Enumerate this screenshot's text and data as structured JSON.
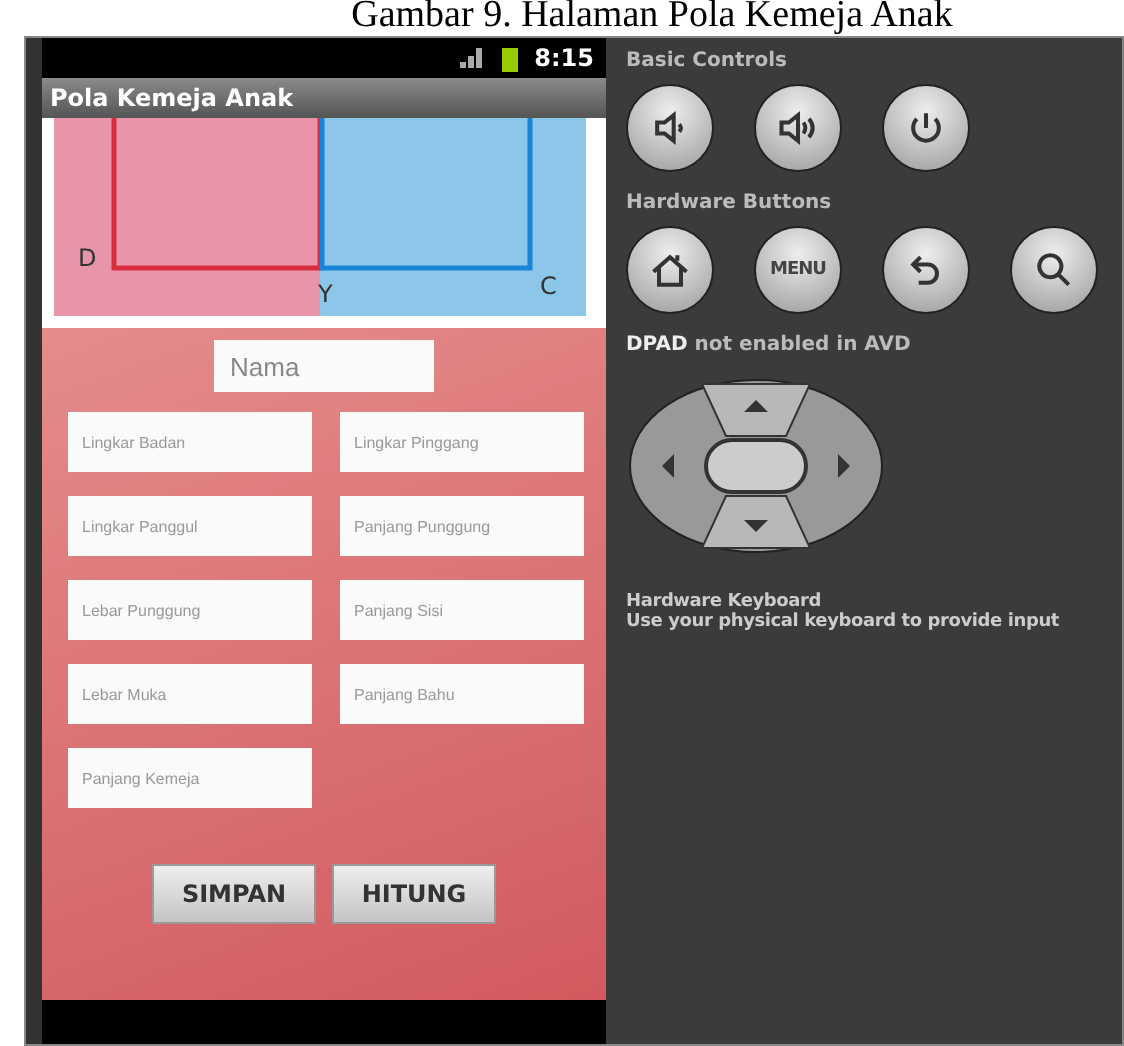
{
  "caption": "Gambar 9. Halaman Pola Kemeja Anak",
  "status_bar": {
    "time": "8:15"
  },
  "app_bar": {
    "title": "Pola Kemeja Anak"
  },
  "diagram": {
    "labels": [
      "D",
      "Y",
      "C"
    ]
  },
  "form": {
    "name_field": {
      "placeholder": "Nama"
    },
    "fields": [
      {
        "placeholder": "Lingkar Badan"
      },
      {
        "placeholder": "Lingkar Pinggang"
      },
      {
        "placeholder": "Lingkar Panggul"
      },
      {
        "placeholder": "Panjang Punggung"
      },
      {
        "placeholder": "Lebar Punggung"
      },
      {
        "placeholder": "Panjang Sisi"
      },
      {
        "placeholder": "Lebar Muka"
      },
      {
        "placeholder": "Panjang Bahu"
      },
      {
        "placeholder": "Panjang Kemeja"
      }
    ],
    "buttons": [
      "SIMPAN",
      "HITUNG"
    ]
  },
  "controls_panel": {
    "sections": [
      {
        "kind": "buttons",
        "title": "Basic Controls",
        "buttons": [
          {
            "kind": "volume-down"
          },
          {
            "kind": "volume-up"
          },
          {
            "kind": "power"
          }
        ]
      },
      {
        "kind": "buttons",
        "title": "Hardware Buttons",
        "buttons": [
          {
            "kind": "home"
          },
          {
            "kind": "menu",
            "label": "MENU"
          },
          {
            "kind": "back"
          },
          {
            "kind": "search"
          }
        ]
      },
      {
        "kind": "dpad",
        "title": "**DPAD** not enabled in AVD"
      },
      {
        "kind": "text",
        "title": "Hardware Keyboard",
        "text": "Use your physical keyboard to provide input"
      }
    ]
  }
}
